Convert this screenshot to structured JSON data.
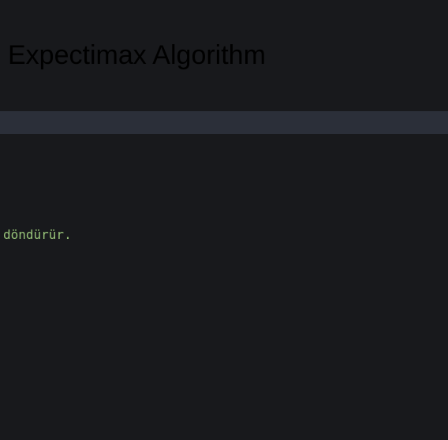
{
  "page": {
    "title": "Expectimax Algorithm"
  },
  "code": {
    "visible_line": "döndürür."
  },
  "colors": {
    "background": "#18191c",
    "band": "#2b2f39",
    "title_text": "#000000",
    "code_text": "#98c379"
  }
}
